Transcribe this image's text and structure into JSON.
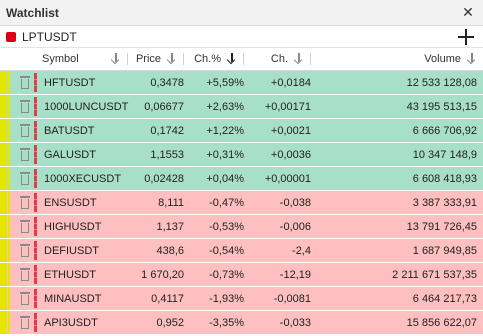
{
  "window": {
    "title": "Watchlist"
  },
  "symbol_bar": {
    "symbol": "LPTUSDT",
    "color": "#d9001b"
  },
  "columns": {
    "symbol": "Symbol",
    "price": "Price",
    "change_pct": "Ch.%",
    "change": "Ch.",
    "volume": "Volume"
  },
  "sort_column": "change_pct",
  "rows": [
    {
      "symbol": "HFTUSDT",
      "price": "0,3478",
      "change_pct": "+5,59%",
      "change": "+0,0184",
      "volume": "12 533 128,08",
      "dir": "up"
    },
    {
      "symbol": "1000LUNCUSDT",
      "price": "0,06677",
      "change_pct": "+2,63%",
      "change": "+0,00171",
      "volume": "43 195 513,15",
      "dir": "up"
    },
    {
      "symbol": "BATUSDT",
      "price": "0,1742",
      "change_pct": "+1,22%",
      "change": "+0,0021",
      "volume": "6 666 706,92",
      "dir": "up"
    },
    {
      "symbol": "GALUSDT",
      "price": "1,1553",
      "change_pct": "+0,31%",
      "change": "+0,0036",
      "volume": "10 347 148,9",
      "dir": "up"
    },
    {
      "symbol": "1000XECUSDT",
      "price": "0,02428",
      "change_pct": "+0,04%",
      "change": "+0,00001",
      "volume": "6 608 418,93",
      "dir": "up"
    },
    {
      "symbol": "ENSUSDT",
      "price": "8,111",
      "change_pct": "-0,47%",
      "change": "-0,038",
      "volume": "3 387 333,91",
      "dir": "down"
    },
    {
      "symbol": "HIGHUSDT",
      "price": "1,137",
      "change_pct": "-0,53%",
      "change": "-0,006",
      "volume": "13 791 726,45",
      "dir": "down"
    },
    {
      "symbol": "DEFIUSDT",
      "price": "438,6",
      "change_pct": "-0,54%",
      "change": "-2,4",
      "volume": "1 687 949,85",
      "dir": "down"
    },
    {
      "symbol": "ETHUSDT",
      "price": "1 670,20",
      "change_pct": "-0,73%",
      "change": "-12,19",
      "volume": "2 211 671 537,35",
      "dir": "down"
    },
    {
      "symbol": "MINAUSDT",
      "price": "0,4117",
      "change_pct": "-1,93%",
      "change": "-0,0081",
      "volume": "6 464 217,73",
      "dir": "down"
    },
    {
      "symbol": "API3USDT",
      "price": "0,952",
      "change_pct": "-3,35%",
      "change": "-0,033",
      "volume": "15 856 622,07",
      "dir": "down"
    }
  ],
  "colors": {
    "up_row": "#a8dfc8",
    "down_row": "#fdbfbf",
    "group_bar": "#e3e600",
    "drag_marker": "#e23b4a"
  }
}
